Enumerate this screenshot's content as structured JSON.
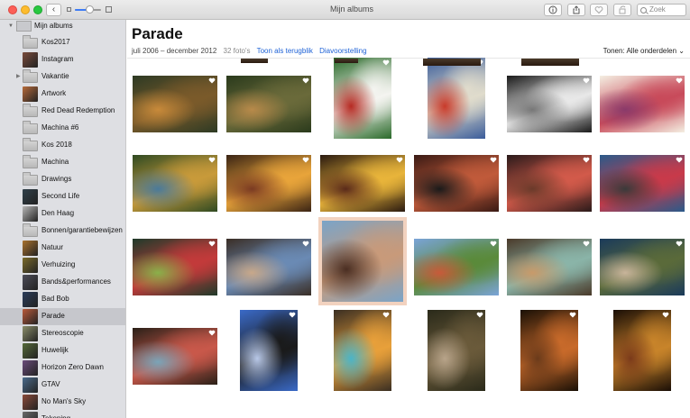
{
  "window": {
    "title": "Mijn albums",
    "back_glyph": "‹",
    "zoom_level_fraction": 0.55,
    "search_placeholder": "Zoek",
    "icons": [
      "info-icon",
      "share-icon",
      "favorite-icon",
      "rotate-icon",
      "search-icon"
    ]
  },
  "sidebar": {
    "root_label": "Mijn albums",
    "items": [
      {
        "label": "Kos2017",
        "kind": "folder"
      },
      {
        "label": "Instagram",
        "kind": "album",
        "color": "#7a4b3b"
      },
      {
        "label": "Vakantie",
        "kind": "folder",
        "expandable": true
      },
      {
        "label": "Artwork",
        "kind": "album",
        "color": "#b66a3a"
      },
      {
        "label": "Red Dead Redemption",
        "kind": "folder"
      },
      {
        "label": "Machina #6",
        "kind": "folder"
      },
      {
        "label": "Kos 2018",
        "kind": "folder"
      },
      {
        "label": "Machina",
        "kind": "folder"
      },
      {
        "label": "Drawings",
        "kind": "folder"
      },
      {
        "label": "Second Life",
        "kind": "album",
        "color": "#30404a"
      },
      {
        "label": "Den Haag",
        "kind": "album",
        "color": "#b7b7b7"
      },
      {
        "label": "Bonnen/garantiebewijzen",
        "kind": "folder"
      },
      {
        "label": "Natuur",
        "kind": "album",
        "color": "#a9722e"
      },
      {
        "label": "Verhuizing",
        "kind": "album",
        "color": "#7a6a2a"
      },
      {
        "label": "Bands&performances",
        "kind": "album",
        "color": "#4c4c58"
      },
      {
        "label": "Bad Bob",
        "kind": "album",
        "color": "#2a3c5a"
      },
      {
        "label": "Parade",
        "kind": "album",
        "color": "#b95a3a",
        "selected": true
      },
      {
        "label": "Stereoscopie",
        "kind": "album",
        "color": "#8a8d6a"
      },
      {
        "label": "Huwelijk",
        "kind": "album",
        "color": "#556a3a"
      },
      {
        "label": "Horizon Zero Dawn",
        "kind": "album",
        "color": "#6a4b7a"
      },
      {
        "label": "GTAV",
        "kind": "album",
        "color": "#4a6a8a"
      },
      {
        "label": "No Man's Sky",
        "kind": "album",
        "color": "#8a4a3a"
      },
      {
        "label": "Tekening",
        "kind": "album",
        "color": "#6a6a6a"
      }
    ]
  },
  "main": {
    "title": "Parade",
    "date_range": "juli 2006 – december 2012",
    "photo_count": "32 foto's",
    "show_as_memory_link": "Toon als terugblik",
    "slideshow_link": "Diavoorstelling",
    "show_filter_label": "Tonen: Alle onderdelen",
    "show_filter_chevron": "⌄"
  },
  "photos": [
    {
      "colors": [
        "#2d3a24",
        "#7a5a2a",
        "#c88a3a"
      ],
      "fav": true
    },
    {
      "colors": [
        "#2a3a1c",
        "#6a6a3a",
        "#b88a4a"
      ],
      "fav": true
    },
    {
      "colors": [
        "#2a6a2a",
        "#f4f4f0",
        "#b62a22"
      ],
      "fav": true
    },
    {
      "colors": [
        "#3a5c9a",
        "#e0dccc",
        "#c83a2a"
      ],
      "fav": true
    },
    {
      "colors": [
        "#1a1a1a",
        "#e8e8e8",
        "#777777"
      ],
      "fav": true
    },
    {
      "colors": [
        "#f4efe2",
        "#c84a5a",
        "#8a3a6a"
      ],
      "fav": true
    },
    {
      "colors": [
        "#2f4a22",
        "#c89a3a",
        "#4a7a9a"
      ],
      "fav": true
    },
    {
      "colors": [
        "#3a2414",
        "#e8a43a",
        "#7a3a22"
      ],
      "fav": true
    },
    {
      "colors": [
        "#2a1a10",
        "#e8b43a",
        "#5a2a1a"
      ],
      "fav": true
    },
    {
      "colors": [
        "#3a1a14",
        "#c05a3a",
        "#1a1a1a"
      ],
      "fav": true
    },
    {
      "colors": [
        "#2a1a1a",
        "#d25a4a",
        "#6a3a2a"
      ],
      "fav": true
    },
    {
      "colors": [
        "#2a5a8a",
        "#c83a4a",
        "#3a3a3a"
      ],
      "fav": true
    },
    {
      "colors": [
        "#1f3a2a",
        "#c23a3a",
        "#8ab04a"
      ],
      "fav": true
    },
    {
      "colors": [
        "#3a2e26",
        "#6a8ab4",
        "#c8a88a"
      ],
      "fav": true
    },
    {
      "colors": [
        "#7aa4c8",
        "#c89a7a",
        "#4a2e22"
      ],
      "fav": false,
      "selected": true
    },
    {
      "colors": [
        "#7aa4d8",
        "#5a8a3a",
        "#c85a3a"
      ],
      "fav": true
    },
    {
      "colors": [
        "#4a3a2a",
        "#8ab4a8",
        "#c89a6a"
      ],
      "fav": true
    },
    {
      "colors": [
        "#1a3a5a",
        "#5a6a3a",
        "#c8b49a"
      ],
      "fav": true
    },
    {
      "colors": [
        "#2a2018",
        "#c8584a",
        "#7aa4b8"
      ],
      "fav": true
    },
    {
      "colors": [
        "#3a6ac8",
        "#1a1a1a",
        "#b8c8e8"
      ],
      "fav": true
    },
    {
      "colors": [
        "#3a2e22",
        "#e8a03a",
        "#4ab4c8"
      ],
      "fav": true
    },
    {
      "colors": [
        "#2a2a1a",
        "#6a5a3a",
        "#b8a48a"
      ],
      "fav": true
    },
    {
      "colors": [
        "#1a1006",
        "#c86a2a",
        "#6a3a1a"
      ],
      "fav": true
    },
    {
      "colors": [
        "#1a0e06",
        "#c8842a",
        "#7a3a1a"
      ],
      "fav": true
    }
  ]
}
